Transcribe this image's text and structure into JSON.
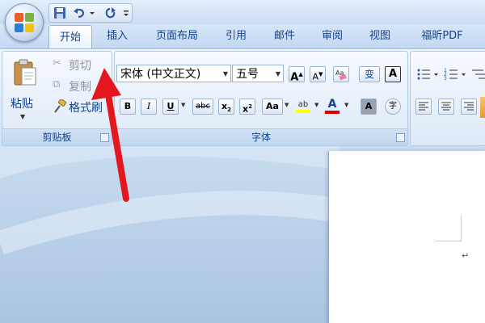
{
  "quick_access": {
    "save_icon": "save-icon",
    "undo_icon": "undo-icon",
    "redo_icon": "redo-icon",
    "customize_icon": "customize-qat-icon"
  },
  "tabs": [
    {
      "label": "开始",
      "active": true
    },
    {
      "label": "插入"
    },
    {
      "label": "页面布局"
    },
    {
      "label": "引用"
    },
    {
      "label": "邮件"
    },
    {
      "label": "审阅"
    },
    {
      "label": "视图"
    },
    {
      "label": "福昕PDF"
    }
  ],
  "clipboard": {
    "group_label": "剪贴板",
    "paste_label": "粘贴",
    "cut_label": "剪切",
    "copy_label": "复制",
    "format_painter_label": "格式刷"
  },
  "font": {
    "group_label": "字体",
    "font_name": "宋体 (中文正文)",
    "font_size": "五号",
    "grow_label": "A",
    "shrink_label": "A",
    "clear_format_icon": "clear-format-icon",
    "phonetic_label": "变",
    "char_border_label": "A",
    "bold_label": "B",
    "italic_label": "I",
    "underline_label": "U",
    "strike_label": "abc",
    "subscript_label": "x",
    "superscript_label": "x",
    "change_case_label": "Aa",
    "highlight_label": "ab",
    "font_color_label": "A",
    "char_shading_label": "A",
    "enclose_label": "字"
  },
  "colors": {
    "arrow": "#e3171d",
    "highlight": "#ffff00",
    "font_color": "#e00000"
  }
}
